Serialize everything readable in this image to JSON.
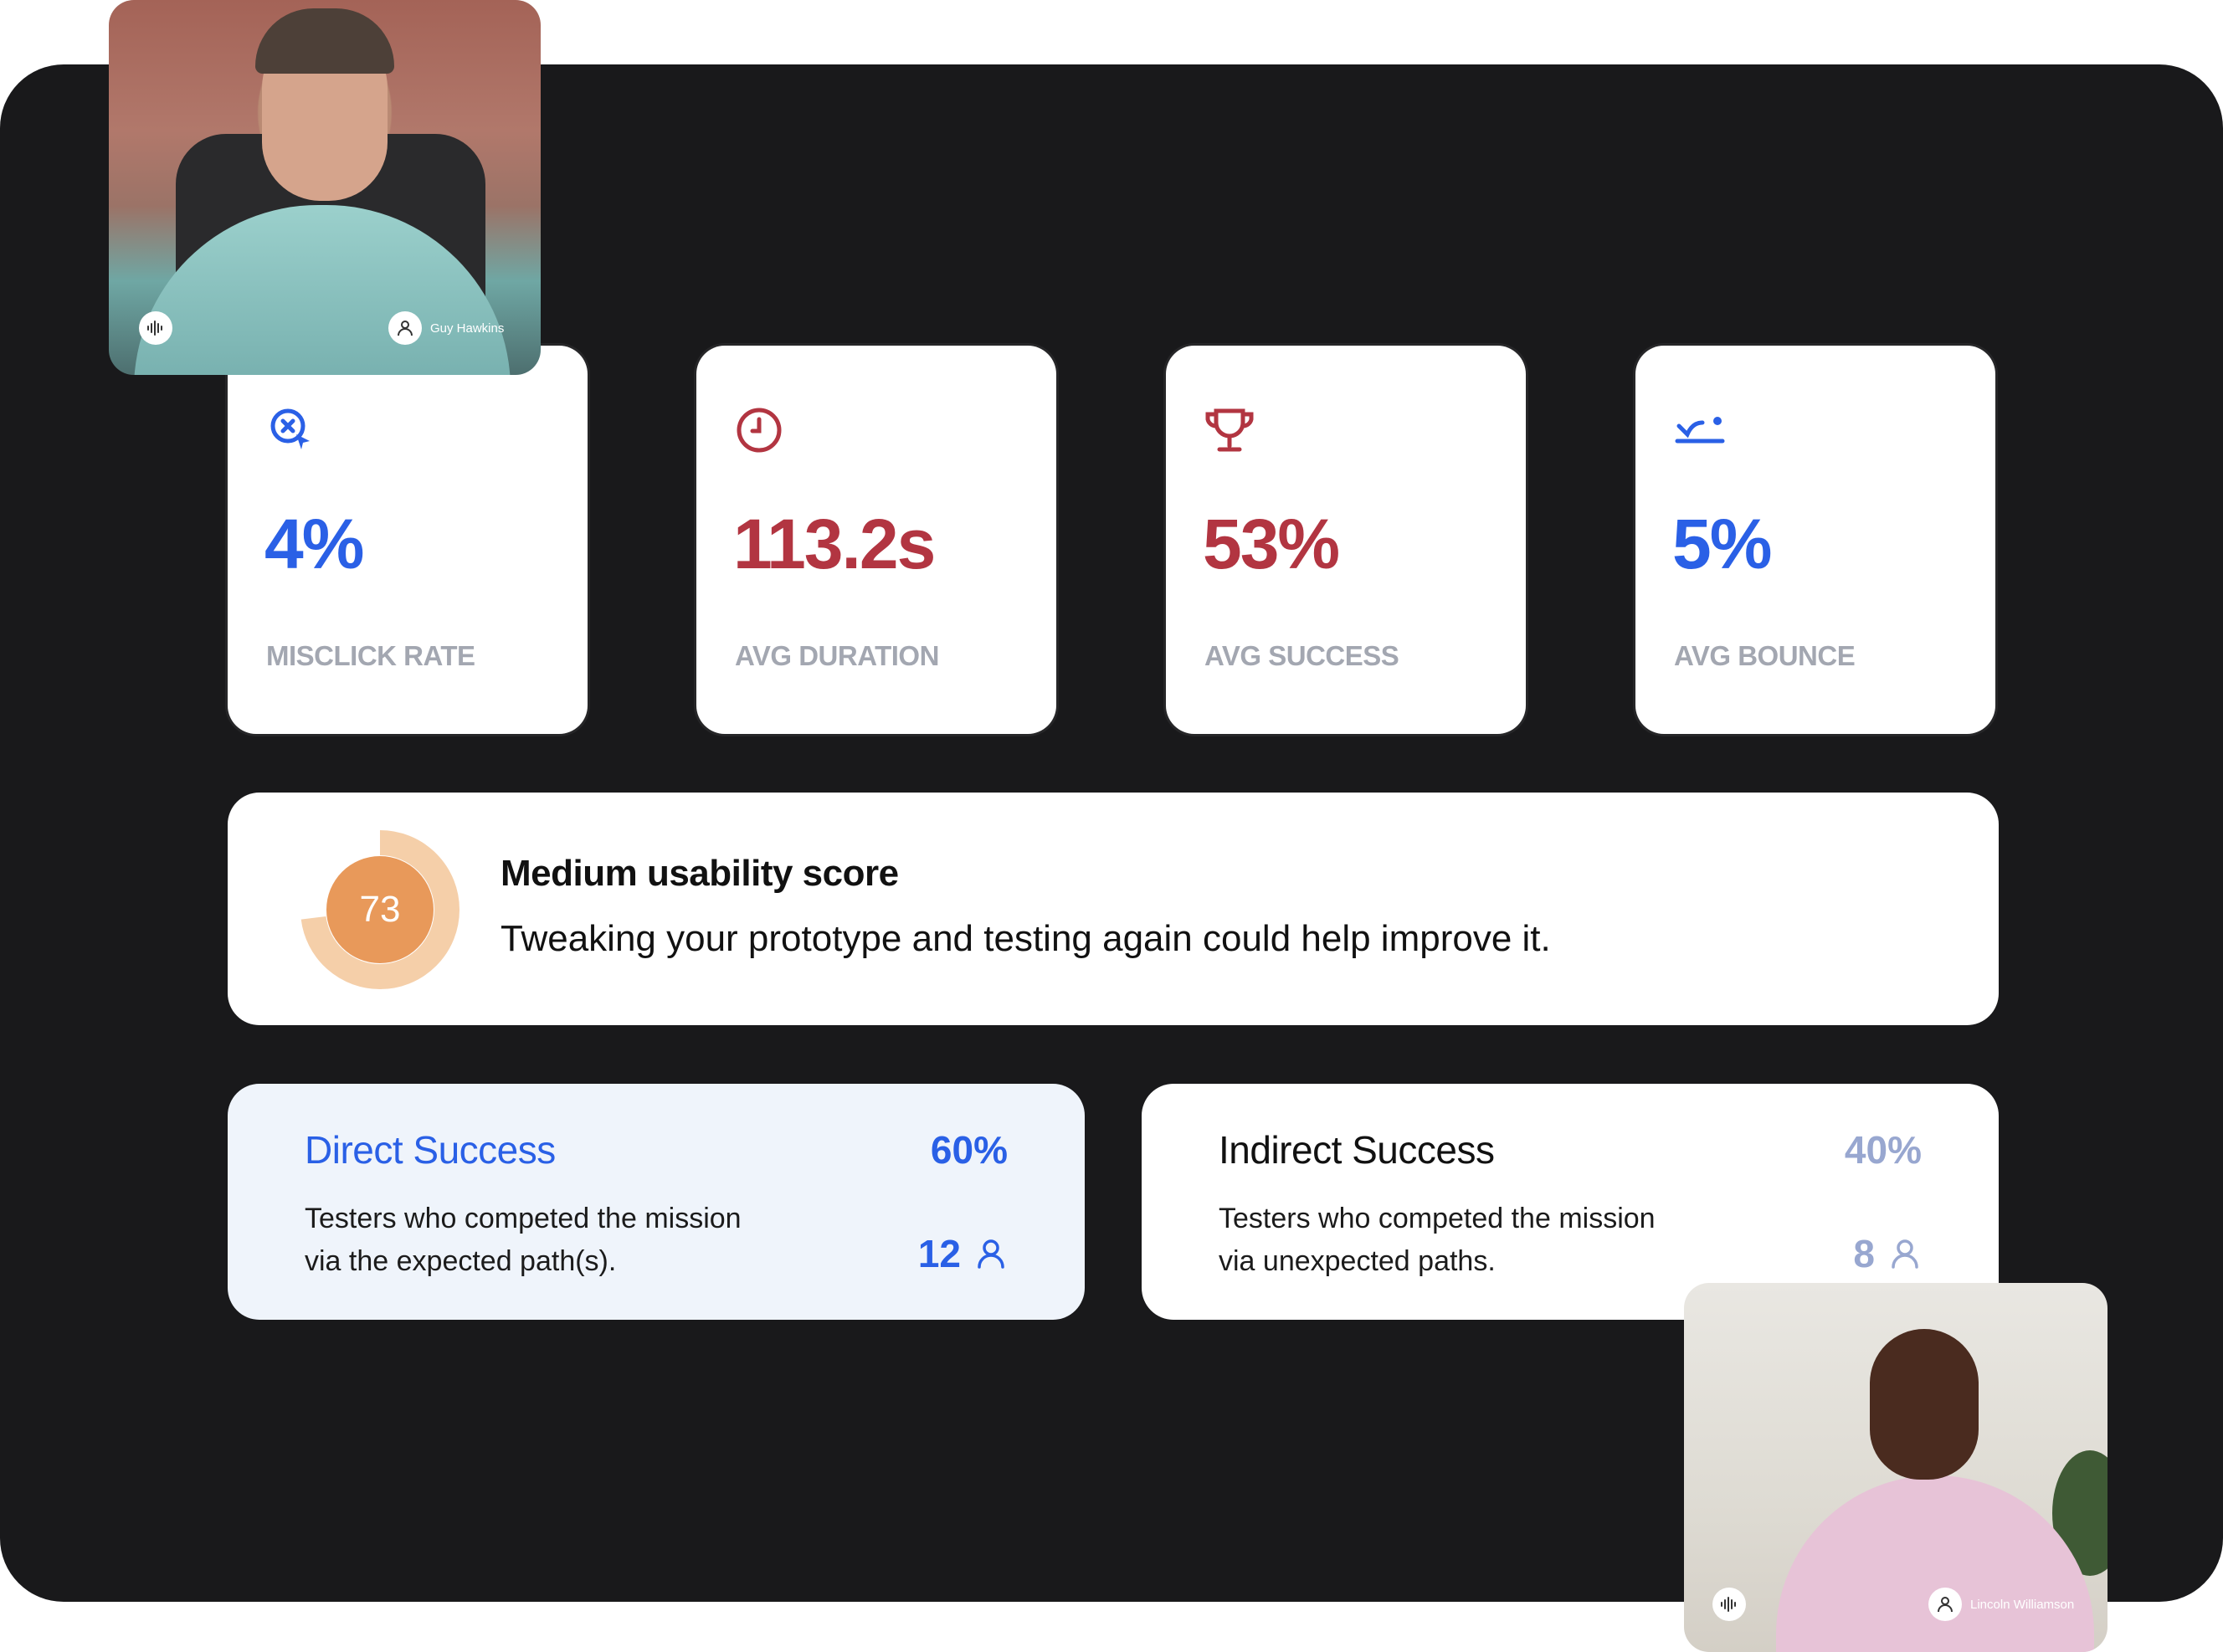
{
  "colors": {
    "blue": "#2a60e6",
    "red": "#b23541",
    "orange": "#e8995a",
    "orange_light": "#f5cfa9",
    "muted_blue": "#98a7d0",
    "panel": "#19191b"
  },
  "stats": [
    {
      "icon": "misclick-icon",
      "value": "4%",
      "label": "MISCLICK RATE"
    },
    {
      "icon": "clock-icon",
      "value": "113.2s",
      "label": "AVG DURATION"
    },
    {
      "icon": "trophy-icon",
      "value": "53%",
      "label": "AVG SUCCESS"
    },
    {
      "icon": "bounce-icon",
      "value": "5%",
      "label": "AVG BOUNCE"
    }
  ],
  "usability": {
    "score": "73",
    "score_fraction": 0.73,
    "title": "Medium usability score",
    "description": "Tweaking your prototype and testing again could help improve it."
  },
  "direct_success": {
    "title": "Direct Success",
    "percent": "60%",
    "description_line1": "Testers who competed the mission",
    "description_line2": "via the expected path(s).",
    "count": "12"
  },
  "indirect_success": {
    "title": "Indirect Success",
    "percent": "40%",
    "description_line1": "Testers who competed the mission",
    "description_line2": "via unexpected paths.",
    "count": "8"
  },
  "videos": [
    {
      "name": "Guy Hawkins",
      "icon": "audio-wave-icon"
    },
    {
      "name": "Lincoln Williamson",
      "icon": "audio-wave-icon"
    }
  ]
}
